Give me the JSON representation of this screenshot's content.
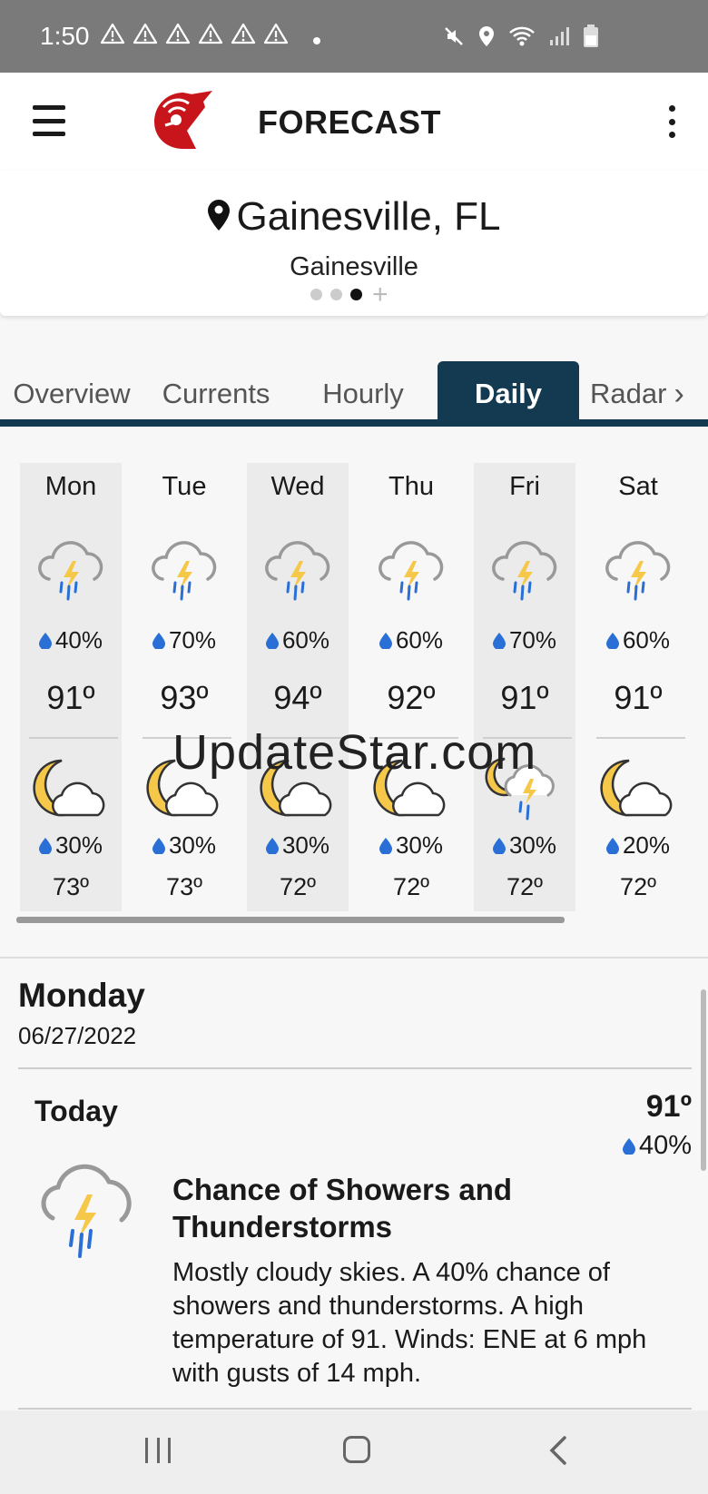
{
  "status_bar": {
    "time": "1:50",
    "warning_count": 6
  },
  "app_bar": {
    "title": "FORECAST",
    "logo_color": "#c8151b"
  },
  "location": {
    "title": "Gainesville, FL",
    "subtitle": "Gainesville",
    "pager_total": 3,
    "pager_active": 3
  },
  "tabs": [
    {
      "label": "Overview",
      "active": false
    },
    {
      "label": "Currents",
      "active": false
    },
    {
      "label": "Hourly",
      "active": false
    },
    {
      "label": "Daily",
      "active": true
    },
    {
      "label": "Radar",
      "active": false
    }
  ],
  "accent_color": "#143a52",
  "rain_color": "#2a6fd6",
  "daily": [
    {
      "day": "Mon",
      "day_icon": "thunderstorm-icon",
      "day_rain": "40%",
      "high": "91º",
      "night_icon": "partly-cloudy-night-icon",
      "night_rain": "30%",
      "low": "73º",
      "shaded": true
    },
    {
      "day": "Tue",
      "day_icon": "thunderstorm-icon",
      "day_rain": "70%",
      "high": "93º",
      "night_icon": "partly-cloudy-night-icon",
      "night_rain": "30%",
      "low": "73º",
      "shaded": false
    },
    {
      "day": "Wed",
      "day_icon": "thunderstorm-icon",
      "day_rain": "60%",
      "high": "94º",
      "night_icon": "partly-cloudy-night-icon",
      "night_rain": "30%",
      "low": "72º",
      "shaded": true
    },
    {
      "day": "Thu",
      "day_icon": "thunderstorm-icon",
      "day_rain": "60%",
      "high": "92º",
      "night_icon": "partly-cloudy-night-icon",
      "night_rain": "30%",
      "low": "72º",
      "shaded": false
    },
    {
      "day": "Fri",
      "day_icon": "thunderstorm-icon",
      "day_rain": "70%",
      "high": "91º",
      "night_icon": "night-thunderstorm-icon",
      "night_rain": "30%",
      "low": "72º",
      "shaded": true
    },
    {
      "day": "Sat",
      "day_icon": "thunderstorm-icon",
      "day_rain": "60%",
      "high": "91º",
      "night_icon": "partly-cloudy-night-icon",
      "night_rain": "20%",
      "low": "72º",
      "shaded": false
    }
  ],
  "watermark": "UpdateStar.com",
  "detail": {
    "day": "Monday",
    "date": "06/27/2022",
    "period": "Today",
    "high": "91º",
    "rain": "40%",
    "icon": "thunderstorm-icon",
    "headline": "Chance of Showers and Thunderstorms",
    "text": "Mostly cloudy skies.  A 40% chance of showers and thunderstorms.  A high temperature of 91.  Winds: ENE at 6 mph with gusts of 14 mph."
  }
}
